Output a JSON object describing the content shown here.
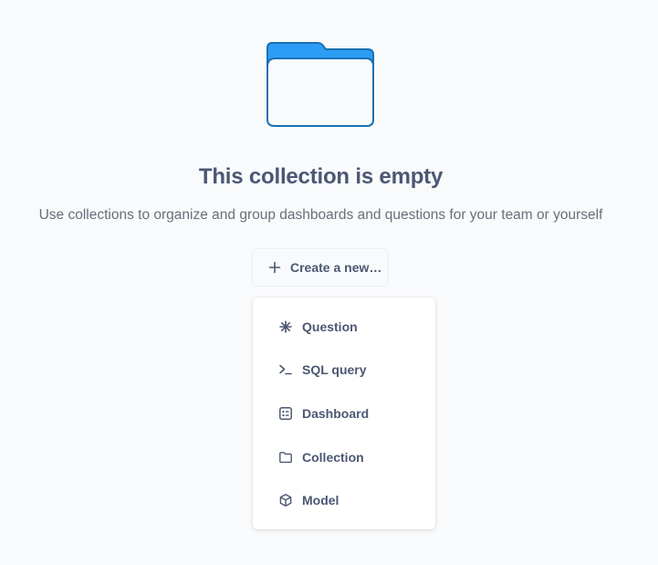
{
  "empty_state": {
    "title": "This collection is empty",
    "subtitle": "Use collections to organize and group dashboards and questions for your team or yourself"
  },
  "create_button": {
    "label": "Create a new…",
    "icon": "plus-icon"
  },
  "menu": {
    "items": [
      {
        "label": "Question",
        "icon": "insight-icon"
      },
      {
        "label": "SQL query",
        "icon": "terminal-icon"
      },
      {
        "label": "Dashboard",
        "icon": "dashboard-icon"
      },
      {
        "label": "Collection",
        "icon": "folder-icon"
      },
      {
        "label": "Model",
        "icon": "cube-icon"
      }
    ]
  },
  "colors": {
    "brand": "#2d9cf4",
    "brand_dark": "#1871b4",
    "text": "#4c5773",
    "background": "#f9fafb"
  }
}
